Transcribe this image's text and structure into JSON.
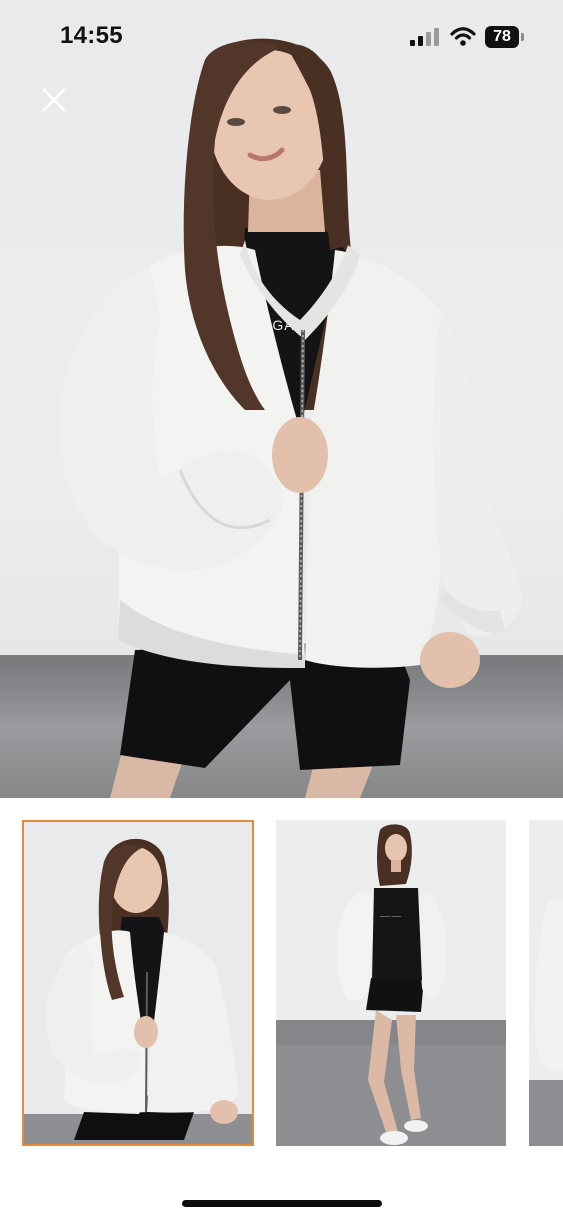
{
  "status_bar": {
    "time": "14:55",
    "battery_level": "78",
    "signal_icon": "cellular-signal-icon",
    "wifi_icon": "wifi-icon"
  },
  "viewer": {
    "close_icon": "close-icon",
    "main_image": "woman wearing white zip-up bomber sweatshirt over black top and black biker shorts",
    "brand_text_on_shirt": "EGAR",
    "thumbnails": [
      {
        "selected": true,
        "subject": "front close-up of white bomber jacket"
      },
      {
        "selected": false,
        "subject": "full-length view, jacket open over black t-shirt, white sneakers"
      },
      {
        "selected": false,
        "subject": "partially visible third photo"
      }
    ]
  },
  "colors": {
    "selected_thumb_border": "#e68a3a",
    "studio_wall": "#e9eaec",
    "studio_floor": "#8c8d90",
    "garment": "#f3f3f1"
  }
}
